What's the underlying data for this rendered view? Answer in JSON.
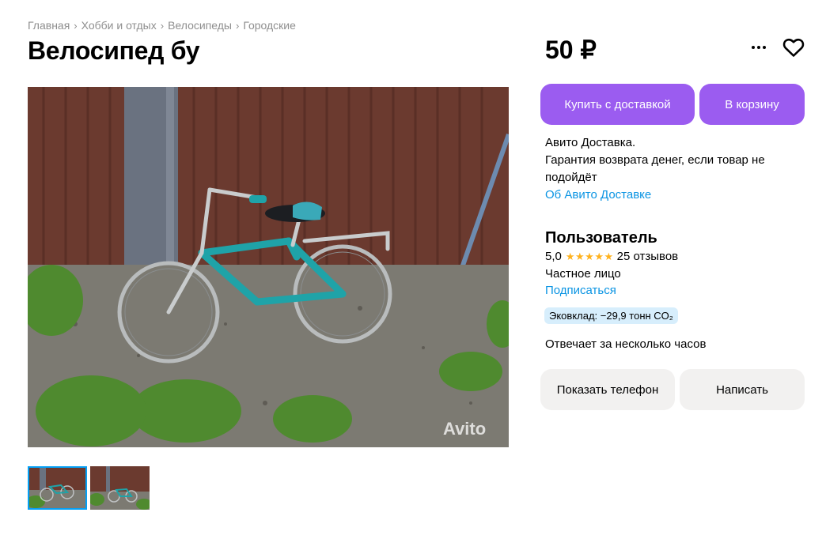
{
  "breadcrumb": [
    "Главная",
    "Хобби и отдых",
    "Велосипеды",
    "Городские"
  ],
  "listing": {
    "title": "Велосипед бу",
    "price": "50 ₽",
    "photo_watermark": "Avito"
  },
  "actions": {
    "buy_with_delivery": "Купить с доставкой",
    "add_to_cart": "В корзину",
    "show_phone": "Показать телефон",
    "write_message": "Написать"
  },
  "delivery": {
    "line1": "Авито Доставка.",
    "line2": "Гарантия возврата денег, если товар не подойдёт",
    "about_link": "Об Авито Доставке"
  },
  "seller": {
    "name": "Пользователь",
    "rating": "5,0",
    "stars": "★★★★★",
    "reviews": "25 отзывов",
    "type": "Частное лицо",
    "subscribe": "Подписаться",
    "eco_badge": "Эковклад: −29,9 тонн CO₂",
    "response_time": "Отвечает за несколько часов"
  },
  "icons": {
    "more": "more-dots-icon",
    "favorite": "heart-icon",
    "breadcrumb_separator": "chevron-right-icon"
  },
  "colors": {
    "primary_button": "#9b5cf0",
    "link": "#0a94e3",
    "secondary_button": "#f2f1f0",
    "eco_badge": "#d7eefc",
    "stars": "#ffb21e"
  }
}
